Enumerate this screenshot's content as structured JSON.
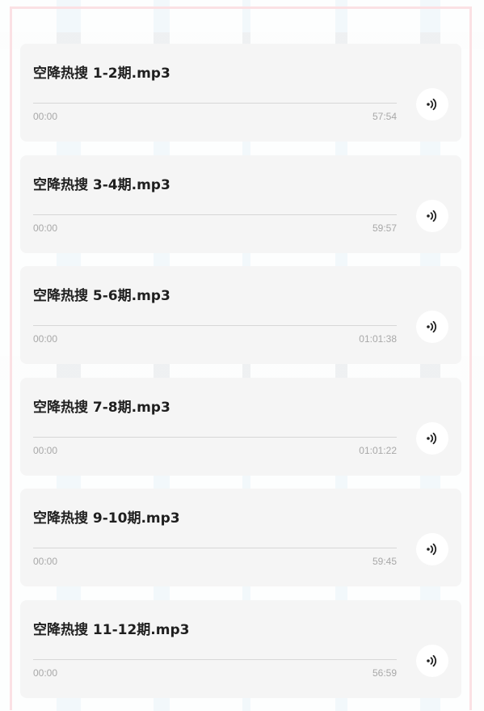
{
  "tracks": [
    {
      "title": "空降热搜 1-2期.mp3",
      "current": "00:00",
      "duration": "57:54",
      "progress": 0
    },
    {
      "title": "空降热搜 3-4期.mp3",
      "current": "00:00",
      "duration": "59:57",
      "progress": 0
    },
    {
      "title": "空降热搜 5-6期.mp3",
      "current": "00:00",
      "duration": "01:01:38",
      "progress": 0
    },
    {
      "title": "空降热搜 7-8期.mp3",
      "current": "00:00",
      "duration": "01:01:22",
      "progress": 0
    },
    {
      "title": "空降热搜 9-10期.mp3",
      "current": "00:00",
      "duration": "59:45",
      "progress": 0
    },
    {
      "title": "空降热搜 11-12期.mp3",
      "current": "00:00",
      "duration": "56:59",
      "progress": 0
    }
  ],
  "icons": {
    "play": "sound-wave-icon"
  },
  "colors": {
    "card_background": "#f5f5f5",
    "title_text": "#1f1f1f",
    "time_text": "#a8a8a8",
    "frame_border": "#fbe1e4"
  }
}
